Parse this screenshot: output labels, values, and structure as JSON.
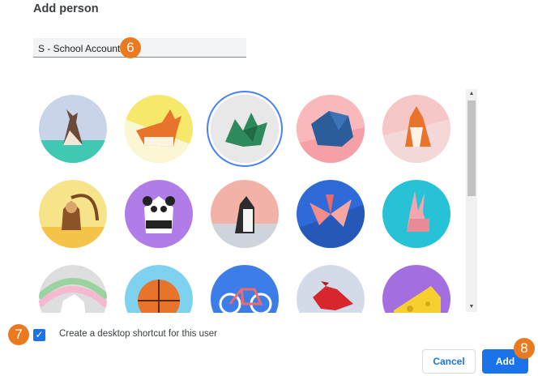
{
  "dialog": {
    "title": "Add person"
  },
  "name_field": {
    "value": "S - School Account"
  },
  "callouts": {
    "name": "6",
    "checkbox": "7",
    "add": "8"
  },
  "avatars": {
    "selected_index": 2,
    "items": [
      {
        "name": "cat-avatar",
        "bg": "#c9d3ea"
      },
      {
        "name": "corgi-avatar",
        "bg": "#f5e86a"
      },
      {
        "name": "dragon-avatar",
        "bg": "#e8e8e8"
      },
      {
        "name": "elephant-avatar",
        "bg": "#f5a0a6"
      },
      {
        "name": "fox-avatar",
        "bg": "#f7c6c6"
      },
      {
        "name": "monkey-avatar",
        "bg": "#f7e48a"
      },
      {
        "name": "panda-avatar",
        "bg": "#b07ce8"
      },
      {
        "name": "penguin-avatar",
        "bg": "#f3b2a8"
      },
      {
        "name": "butterfly-avatar",
        "bg": "#2e6ad8"
      },
      {
        "name": "rabbit-avatar",
        "bg": "#28c2d6"
      },
      {
        "name": "unicorn-avatar",
        "bg": "#dedede"
      },
      {
        "name": "basketball-avatar",
        "bg": "#7fd1f0"
      },
      {
        "name": "bicycle-avatar",
        "bg": "#3d7de8"
      },
      {
        "name": "bird-avatar",
        "bg": "#d4dbe8"
      },
      {
        "name": "cheese-avatar",
        "bg": "#a26ee0"
      }
    ]
  },
  "shortcut": {
    "checked": true,
    "label": "Create a desktop shortcut for this user"
  },
  "buttons": {
    "cancel": "Cancel",
    "add": "Add"
  }
}
